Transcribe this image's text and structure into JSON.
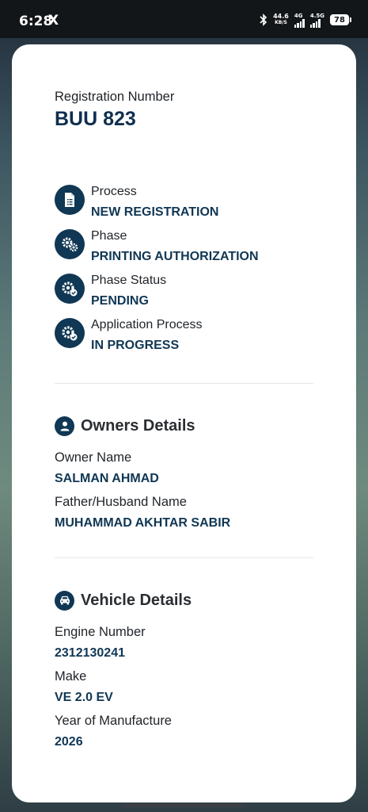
{
  "status_bar": {
    "time": "6:28",
    "x_icon": "X",
    "net_speed_value": "44.6",
    "net_speed_unit": "KB/S",
    "signal1_label": "4G",
    "signal2_label": "4.5G",
    "battery": "78"
  },
  "registration": {
    "label": "Registration Number",
    "number": "BUU 823"
  },
  "status_items": [
    {
      "label": "Process",
      "value": "NEW REGISTRATION",
      "icon": "document-icon"
    },
    {
      "label": "Phase",
      "value": "PRINTING AUTHORIZATION",
      "icon": "gears-icon"
    },
    {
      "label": "Phase Status",
      "value": "PENDING",
      "icon": "gear-check-icon"
    },
    {
      "label": "Application Process",
      "value": "IN PROGRESS",
      "icon": "gear-check-icon"
    }
  ],
  "owners": {
    "title": "Owners Details",
    "icon": "person-icon",
    "owner_name_label": "Owner Name",
    "owner_name": "SALMAN AHMAD",
    "father_label": "Father/Husband Name",
    "father_name": "MUHAMMAD AKHTAR SABIR"
  },
  "vehicle": {
    "title": "Vehicle Details",
    "icon": "car-icon",
    "engine_label": "Engine Number",
    "engine_number": "2312130241",
    "make_label": "Make",
    "make": "VE 2.0 EV",
    "year_label": "Year of Manufacture",
    "year": "2026"
  },
  "colors": {
    "accent": "#103754",
    "status_bar": "#131619",
    "card": "#ffffff"
  }
}
